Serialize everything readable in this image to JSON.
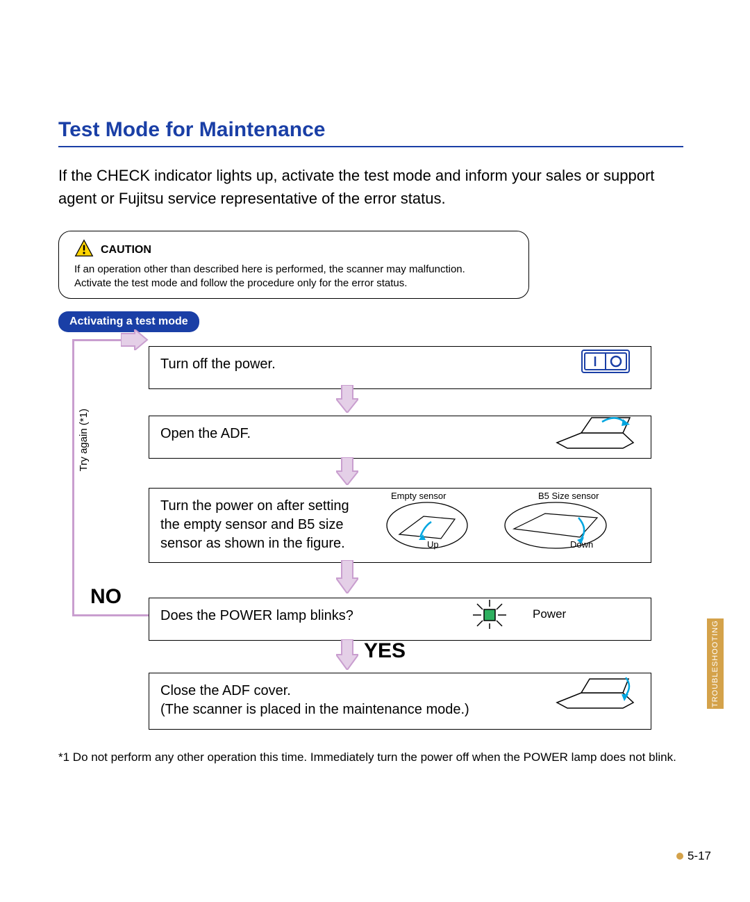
{
  "heading": "Test Mode for Maintenance",
  "intro": "If the CHECK indicator lights up, activate the test mode and inform your sales or support agent or Fujitsu service representative of the error status.",
  "caution": {
    "title": "CAUTION",
    "line1": "If an operation other than described here is performed, the scanner may malfunction.",
    "line2": "Activate the test mode and follow the procedure only for the error status."
  },
  "pill": "Activating a test mode",
  "steps": {
    "s1": "Turn off the power.",
    "s2": "Open the ADF.",
    "s3": "Turn the power on after setting the empty sensor and B5 size sensor as shown in the figure.",
    "s4": "Does the POWER  lamp blinks?",
    "s5a": "Close the ADF cover.",
    "s5b": "(The scanner is placed in the maintenance mode.)"
  },
  "labels": {
    "yes": "YES",
    "no": "NO",
    "try_again": "Try again (*1)",
    "empty_sensor": "Empty sensor",
    "b5_sensor": "B5 Size sensor",
    "up": "Up",
    "down": "Down",
    "power": "Power"
  },
  "footnote": "*1  Do not perform any other operation this time. Immediately turn the power off when the POWER lamp does not blink.",
  "side_tab": "TROUBLESHOOTING",
  "page_number": "5-17"
}
